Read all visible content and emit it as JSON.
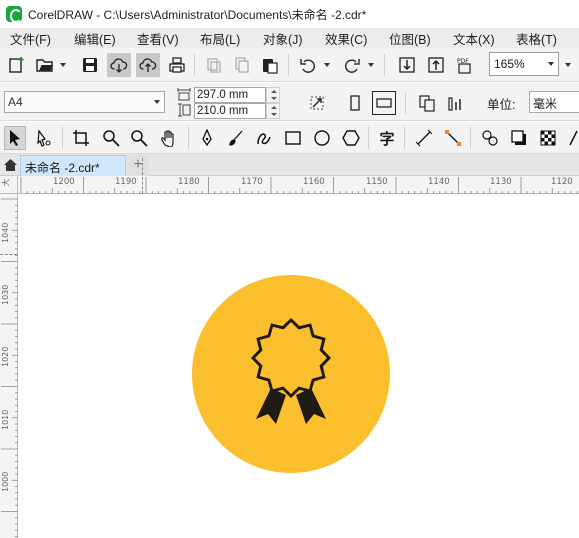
{
  "window": {
    "title": "CorelDRAW - C:\\Users\\Administrator\\Documents\\未命名 -2.cdr*"
  },
  "menu": [
    {
      "label": "文件(F)"
    },
    {
      "label": "编辑(E)"
    },
    {
      "label": "查看(V)"
    },
    {
      "label": "布局(L)"
    },
    {
      "label": "对象(J)"
    },
    {
      "label": "效果(C)"
    },
    {
      "label": "位图(B)"
    },
    {
      "label": "文本(X)"
    },
    {
      "label": "表格(T)"
    }
  ],
  "toolbar": {
    "zoom_value": "165%",
    "icons": [
      "new-document-icon",
      "open-folder-icon",
      "save-icon",
      "cloud-download-icon",
      "cloud-upload-icon",
      "print-icon",
      "cut-icon",
      "copy-icon",
      "paste-icon",
      "undo-icon",
      "redo-icon",
      "import-icon",
      "export-icon",
      "publish-pdf-icon"
    ],
    "pdf_label": "PDF"
  },
  "property_bar": {
    "page_size": "A4",
    "width": "297.0 mm",
    "height": "210.0 mm",
    "unit_label": "单位:",
    "unit_value": "毫米"
  },
  "document": {
    "tab_label": "未命名 -2.cdr*",
    "add_tab": "+"
  },
  "rulers": {
    "horizontal": [
      "1200",
      "1190",
      "1180",
      "1170",
      "1160",
      "1150",
      "1140",
      "1130",
      "1120"
    ],
    "vertical": [
      "1040",
      "1030",
      "1020",
      "1010",
      "1000"
    ],
    "corner": "大"
  },
  "artwork": {
    "circle_color": "#FBBF2E",
    "badge_color": "#1F1B14",
    "description_icon": "award-ribbon-badge"
  }
}
